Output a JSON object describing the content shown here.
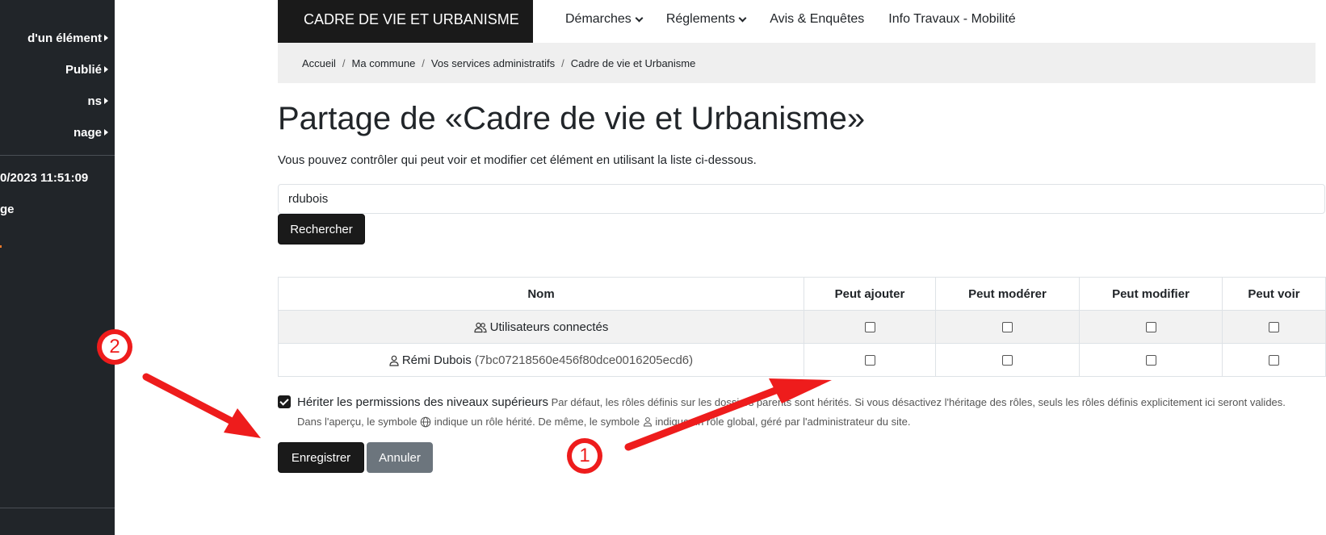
{
  "sidebar": {
    "items": [
      {
        "label": "d'un élément"
      },
      {
        "label": "Publié"
      },
      {
        "label": "ns"
      },
      {
        "label": "nage"
      }
    ],
    "timestamp": "0/2023 11:51:09",
    "extra": "ge"
  },
  "header": {
    "brand": "CADRE DE VIE ET URBANISME",
    "nav": [
      "Démarches",
      "Réglements",
      "Avis & Enquêtes",
      "Info Travaux - Mobilité"
    ]
  },
  "breadcrumb": [
    "Accueil",
    "Ma commune",
    "Vos services administratifs",
    "Cadre de vie et Urbanisme"
  ],
  "breadcrumb_sep": "/",
  "main": {
    "title": "Partage de «Cadre de vie et Urbanisme»",
    "intro": "Vous pouvez contrôler qui peut voir et modifier cet élément en utilisant la liste ci-dessous.",
    "search_value": "rdubois",
    "search_button": "Rechercher"
  },
  "table": {
    "headers": [
      "Nom",
      "Peut ajouter",
      "Peut modérer",
      "Peut modifier",
      "Peut voir"
    ],
    "rows": [
      {
        "name": "Utilisateurs connectés",
        "id": "",
        "icon": "group-icon"
      },
      {
        "name": "Rémi Dubois",
        "id": "(7bc07218560e456f80dce0016205ecd6)",
        "icon": "user-icon"
      }
    ]
  },
  "inherit": {
    "label": "Hériter les permissions des niveaux supérieurs",
    "desc1": "Par défaut, les rôles définis sur les dossiers parents sont hérités. Si vous désactivez l'héritage des rôles, seuls les rôles définis explicitement ici seront valides.",
    "desc2_a": "Dans l'aperçu, le symbole",
    "desc2_b": "indique un rôle hérité. De même, le symbole",
    "desc2_c": "indique un rôle global, géré par l'administrateur du site."
  },
  "actions": {
    "save": "Enregistrer",
    "cancel": "Annuler"
  },
  "annotations": {
    "badge1": "1",
    "badge2": "2",
    "color": "#ee1c1c"
  }
}
